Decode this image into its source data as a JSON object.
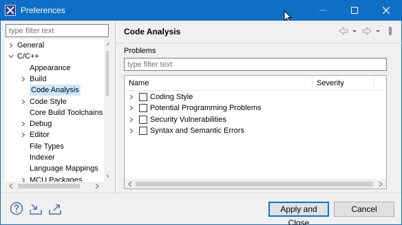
{
  "window": {
    "title": "Preferences"
  },
  "sidebar": {
    "filter_placeholder": "type filter text",
    "items": [
      {
        "label": "General",
        "expanded": false,
        "has_children": true,
        "level": 0
      },
      {
        "label": "C/C++",
        "expanded": true,
        "has_children": true,
        "level": 0
      },
      {
        "label": "Appearance",
        "has_children": false,
        "level": 1
      },
      {
        "label": "Build",
        "expanded": false,
        "has_children": true,
        "level": 1
      },
      {
        "label": "Code Analysis",
        "has_children": false,
        "level": 1,
        "selected": true
      },
      {
        "label": "Code Style",
        "expanded": false,
        "has_children": true,
        "level": 1
      },
      {
        "label": "Core Build Toolchains",
        "has_children": false,
        "level": 1
      },
      {
        "label": "Debug",
        "expanded": false,
        "has_children": true,
        "level": 1
      },
      {
        "label": "Editor",
        "expanded": false,
        "has_children": true,
        "level": 1
      },
      {
        "label": "File Types",
        "has_children": false,
        "level": 1
      },
      {
        "label": "Indexer",
        "has_children": false,
        "level": 1
      },
      {
        "label": "Language Mappings",
        "has_children": false,
        "level": 1
      },
      {
        "label": "MCU Packages",
        "expanded": false,
        "has_children": true,
        "level": 1
      }
    ]
  },
  "main": {
    "page_title": "Code Analysis",
    "problems_label": "Problems",
    "filter_placeholder": "type filter text",
    "columns": [
      "Name",
      "Severity"
    ],
    "problems": [
      {
        "label": "Coding Style",
        "checked": false
      },
      {
        "label": "Potential Programming Problems",
        "checked": false
      },
      {
        "label": "Security Vulnerabilities",
        "checked": false
      },
      {
        "label": "Syntax and Semantic Errors",
        "checked": false
      }
    ]
  },
  "footer": {
    "apply_close_label": "Apply and Close",
    "cancel_label": "Cancel",
    "icons": [
      "help-icon",
      "import-icon",
      "export-icon"
    ]
  },
  "colors": {
    "titlebar": "#0f6fc6",
    "selection": "#cce8ff",
    "primary_border": "#0078d7"
  }
}
